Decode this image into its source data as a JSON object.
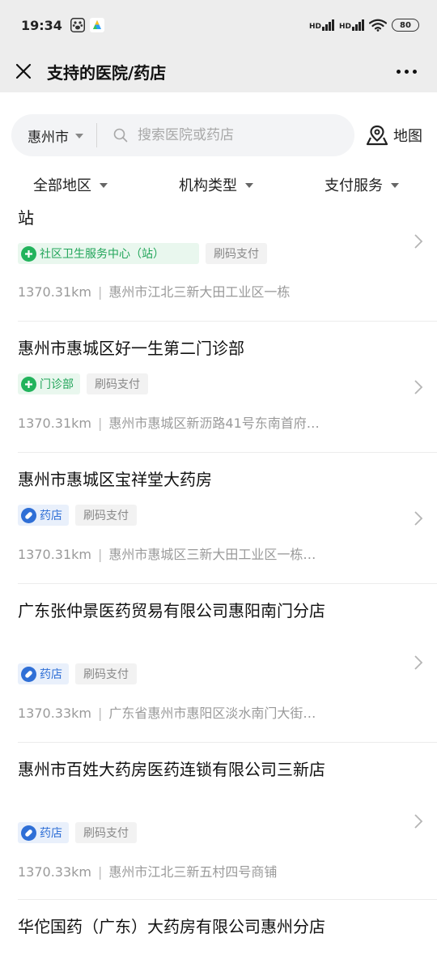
{
  "status": {
    "time": "19:34",
    "battery": "80",
    "net1": "HD",
    "net2": "HD"
  },
  "nav": {
    "title": "支持的医院/药店"
  },
  "search": {
    "city": "惠州市",
    "placeholder": "搜索医院或药店",
    "map_label": "地图"
  },
  "filters": [
    "全部地区",
    "机构类型",
    "支付服务"
  ],
  "items": [
    {
      "title": "站",
      "type_tag": "社区卫生服务中心（站）",
      "pay_tag": "刷码支付",
      "distance": "1370.31km",
      "address": "惠州市江北三新大田工业区一栋"
    },
    {
      "title": "惠州市惠城区好一生第二门诊部",
      "type_tag": "门诊部",
      "pay_tag": "刷码支付",
      "distance": "1370.31km",
      "address": "惠州市惠城区新沥路41号东南首府…"
    },
    {
      "title": "惠州市惠城区宝祥堂大药房",
      "type_tag": "药店",
      "pay_tag": "刷码支付",
      "distance": "1370.31km",
      "address": "惠州市惠城区三新大田工业区一栋…"
    },
    {
      "title": "广东张仲景医药贸易有限公司惠阳南门分店",
      "type_tag": "药店",
      "pay_tag": "刷码支付",
      "distance": "1370.33km",
      "address": "广东省惠州市惠阳区淡水南门大街…"
    },
    {
      "title": "惠州市百姓大药房医药连锁有限公司三新店",
      "type_tag": "药店",
      "pay_tag": "刷码支付",
      "distance": "1370.33km",
      "address": "惠州市江北三新五村四号商铺"
    },
    {
      "title": "华佗国药（广东）大药房有限公司惠州分店"
    }
  ],
  "colors": {
    "green": "#22a55a",
    "blue": "#2f6fd6",
    "gray_text": "#9a9a9a"
  },
  "icons": [
    "close-icon",
    "more-icon",
    "search-icon",
    "map-pin-icon",
    "chevron-right-icon",
    "plus-cross-icon",
    "pill-icon"
  ]
}
